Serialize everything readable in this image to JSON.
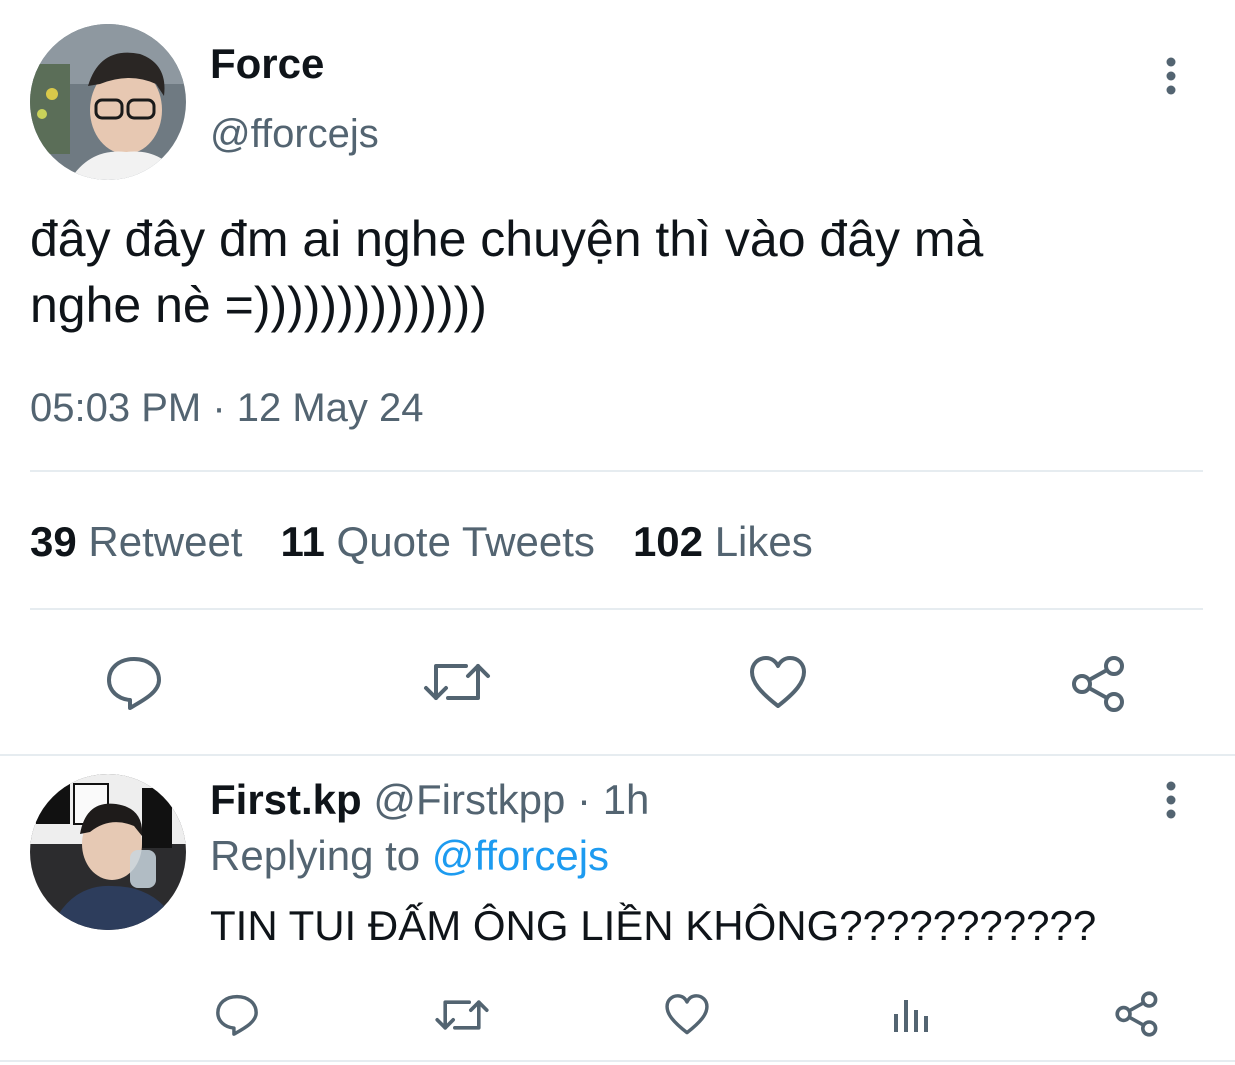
{
  "main_tweet": {
    "display_name": "Force",
    "handle": "@fforcejs",
    "text_line1": "đây đây đm ai nghe chuyện thì vào đây mà",
    "text_line2": "nghe nè =))))))))))))))",
    "timestamp": "05:03 PM · 12 May 24",
    "stats": {
      "retweets_count": "39",
      "retweets_label": "Retweet",
      "quotes_count": "11",
      "quotes_label": "Quote Tweets",
      "likes_count": "102",
      "likes_label": "Likes"
    },
    "actions": [
      "reply-icon",
      "retweet-icon",
      "like-icon",
      "share-icon"
    ]
  },
  "reply_tweet": {
    "display_name": "First.kp",
    "handle": "@Firstkpp",
    "time": "· 1h",
    "replying_prefix": "Replying to",
    "replying_handle": "@fforcejs",
    "text": "TIN TUI ĐẤM ÔNG LIỀN KHÔNG???????????",
    "actions": [
      "reply-icon",
      "retweet-icon",
      "like-icon",
      "analytics-icon",
      "share-icon"
    ]
  },
  "colors": {
    "text": "#0f1419",
    "muted": "#536471",
    "link": "#1d9bf0",
    "divider": "#e6ecf0"
  }
}
